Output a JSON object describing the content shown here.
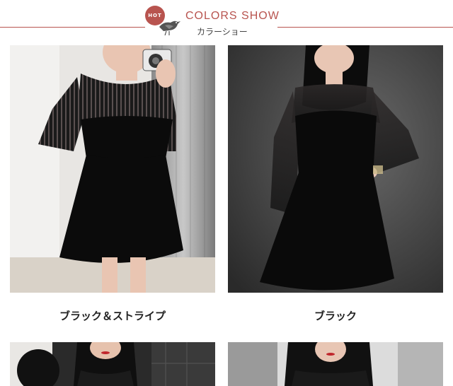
{
  "header": {
    "badge": "HOT",
    "title": "COLORS SHOW",
    "subtitle": "カラーショー"
  },
  "items": [
    {
      "caption": "ブラック＆ストライプ",
      "icon": "photo"
    },
    {
      "caption": "ブラック",
      "icon": "photo"
    }
  ],
  "colors": {
    "accent": "#b8544f",
    "dress": "#0b0b0b"
  }
}
